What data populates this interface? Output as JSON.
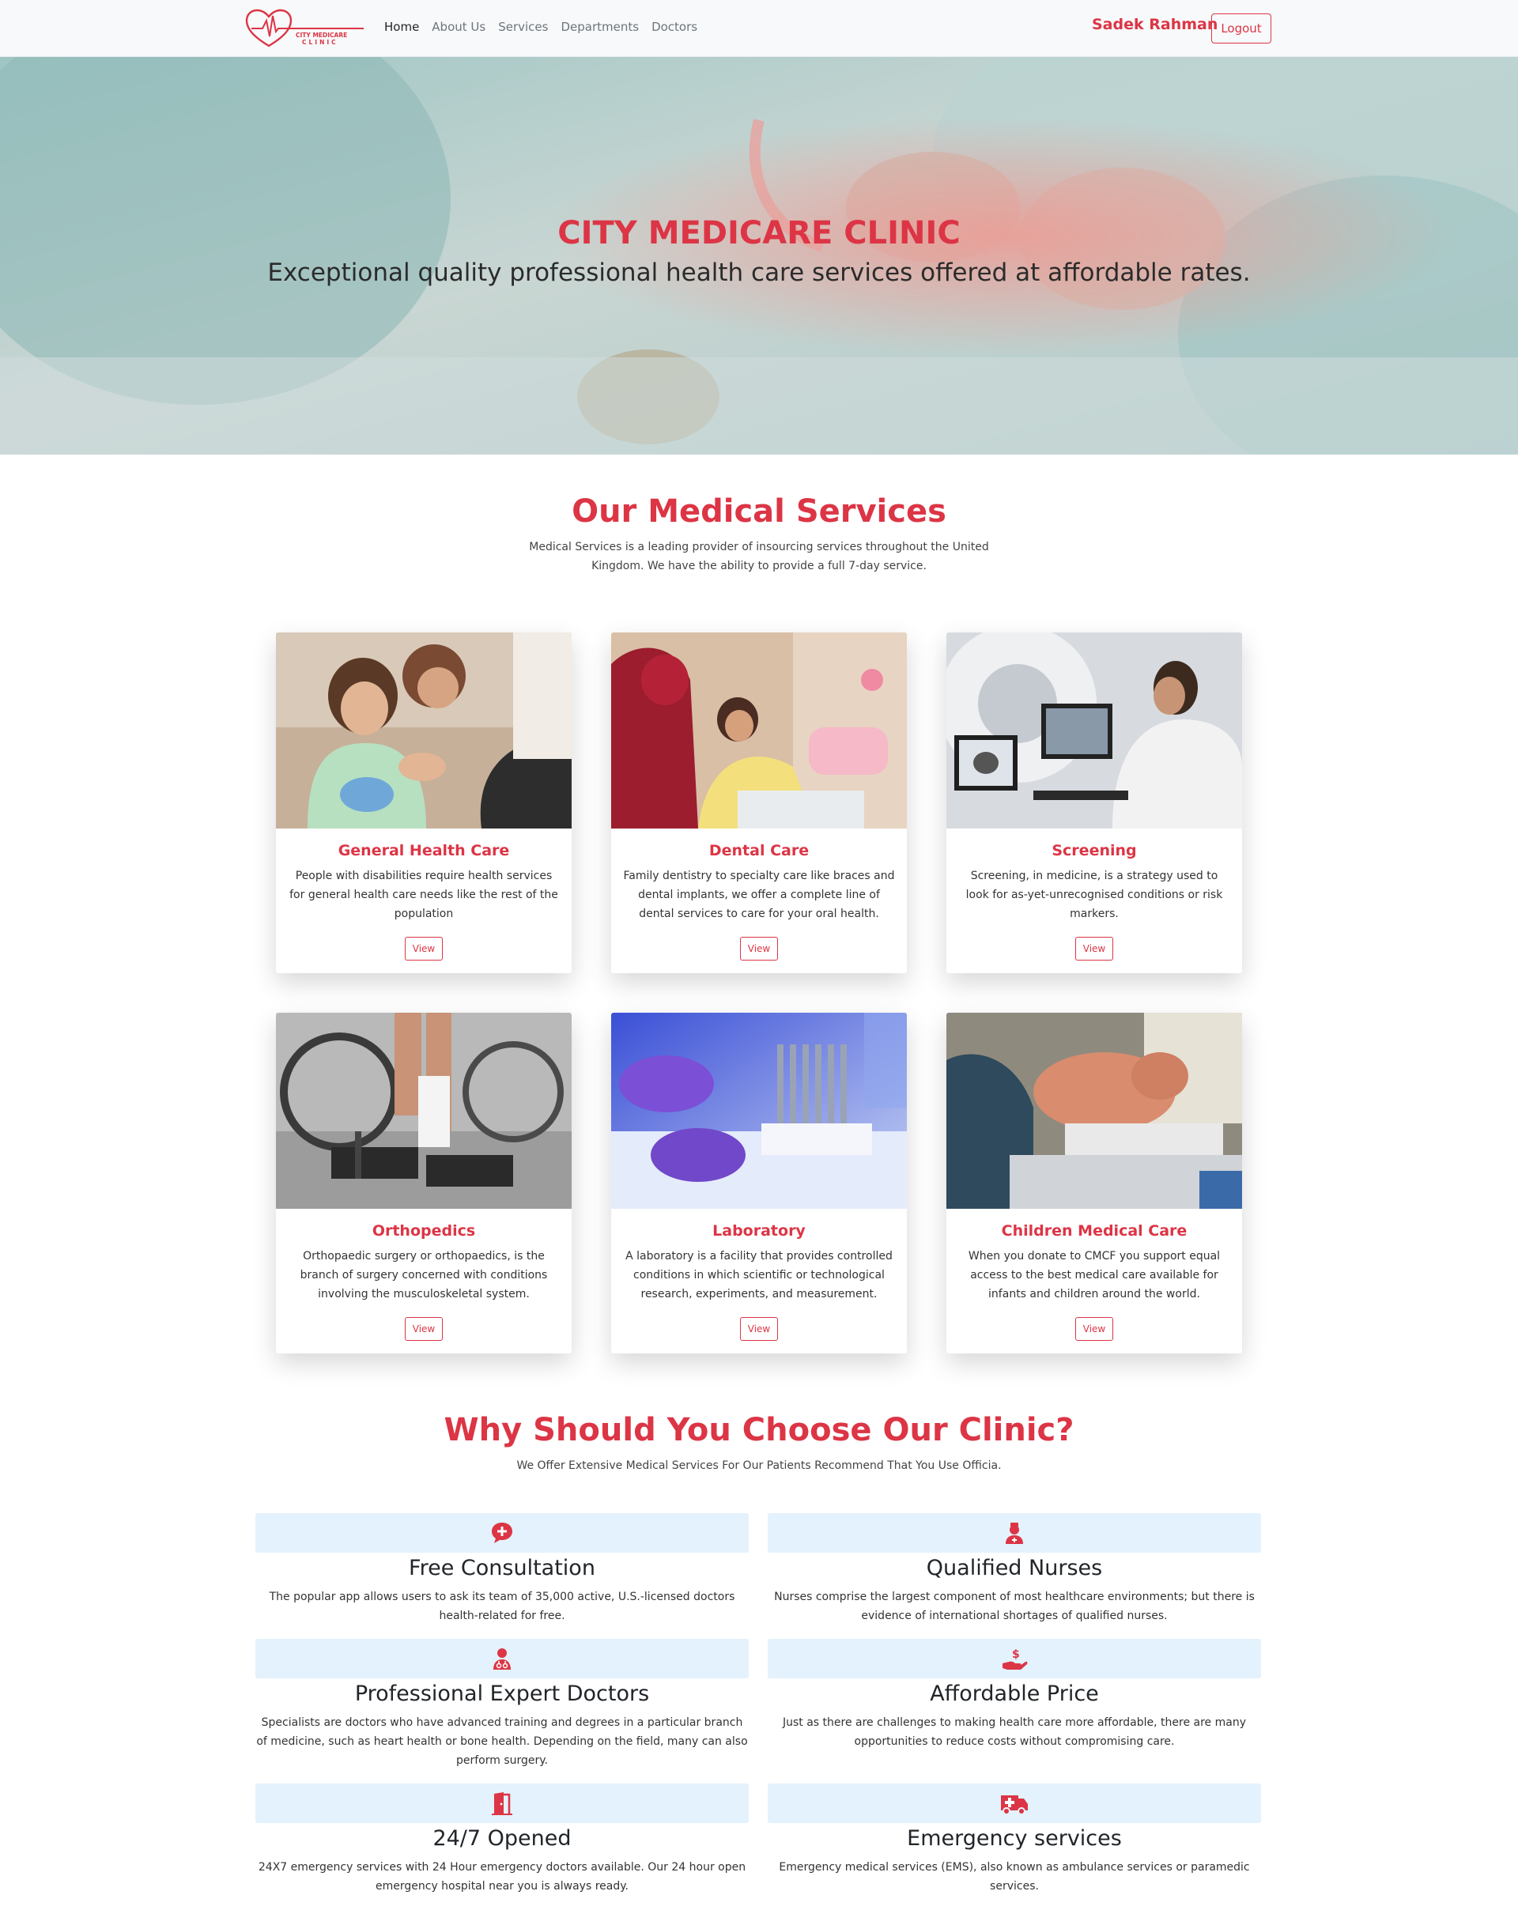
{
  "navbar": {
    "logo_text_top": "CITY MEDICARE",
    "logo_text_bottom": "CLINIC",
    "links": [
      "Home",
      "About Us",
      "Services",
      "Departments",
      "Doctors"
    ],
    "user_name": "Sadek Rahman",
    "logout_label": "Logout"
  },
  "hero": {
    "title": "CITY MEDICARE CLINIC",
    "subtitle": "Exceptional quality professional health care services offered at affordable rates."
  },
  "services": {
    "title": "Our Medical Services",
    "description": "Medical Services is a leading provider of insourcing services throughout the United Kingdom. We have the ability to provide a full 7-day service.",
    "cards": [
      {
        "title": "General Health Care",
        "text": "People with disabilities require health services for general health care needs like the rest of the population",
        "button": "View"
      },
      {
        "title": "Dental Care",
        "text": "Family dentistry to specialty care like braces and dental implants, we offer a complete line of dental services to care for your oral health.",
        "button": "View"
      },
      {
        "title": "Screening",
        "text": "Screening, in medicine, is a strategy used to look for as-yet-unrecognised conditions or risk markers.",
        "button": "View"
      },
      {
        "title": "Orthopedics",
        "text": "Orthopaedic surgery or orthopaedics, is the branch of surgery concerned with conditions involving the musculoskeletal system.",
        "button": "View"
      },
      {
        "title": "Laboratory",
        "text": "A laboratory is a facility that provides controlled conditions in which scientific or technological research, experiments, and measurement.",
        "button": "View"
      },
      {
        "title": "Children Medical Care",
        "text": "When you donate to CMCF you support equal access to the best medical care available for infants and children around the world.",
        "button": "View"
      }
    ]
  },
  "why": {
    "title": "Why Should You Choose Our Clinic?",
    "description": "We Offer Extensive Medical Services For Our Patients Recommend That You Use Officia.",
    "features": [
      {
        "icon": "chat-medical-icon",
        "title": "Free Consultation",
        "text": "The popular app allows users to ask its team of 35,000 active, U.S.-licensed doctors health-related for free."
      },
      {
        "icon": "nurse-icon",
        "title": "Qualified Nurses",
        "text": "Nurses comprise the largest component of most healthcare environments; but there is evidence of international shortages of qualified nurses."
      },
      {
        "icon": "doctor-icon",
        "title": "Professional Expert Doctors",
        "text": "Specialists are doctors who have advanced training and degrees in a particular branch of medicine, such as heart health or bone health. Depending on the field, many can also perform surgery."
      },
      {
        "icon": "hand-dollar-icon",
        "title": "Affordable Price",
        "text": "Just as there are challenges to making health care more affordable, there are many opportunities to reduce costs without compromising care."
      },
      {
        "icon": "door-open-icon",
        "title": "24/7 Opened",
        "text": "24X7 emergency services with 24 Hour emergency doctors available. Our 24 hour open emergency hospital near you is always ready."
      },
      {
        "icon": "ambulance-icon",
        "title": "Emergency services",
        "text": "Emergency medical services (EMS), also known as ambulance services or paramedic services."
      }
    ]
  },
  "colors": {
    "accent": "#dc3545",
    "feature_band": "#e3f2fd",
    "navbar_bg": "#f8f9fa"
  }
}
